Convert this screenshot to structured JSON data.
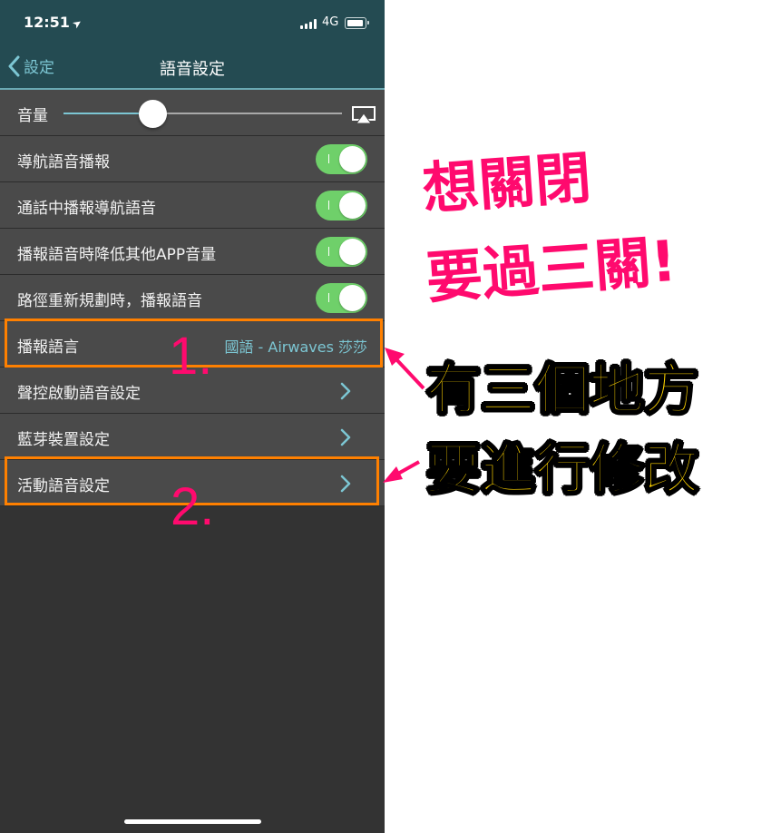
{
  "status_bar": {
    "time": "12:51",
    "location_icon": "location-arrow-icon",
    "network": "4G",
    "signal_icon": "signal-bars-icon",
    "battery_icon": "battery-icon"
  },
  "nav": {
    "back_label": "設定",
    "title": "語音設定"
  },
  "volume": {
    "label": "音量",
    "level_percent": 32,
    "airplay_icon": "airplay-icon"
  },
  "rows": [
    {
      "label": "導航語音播報",
      "type": "toggle",
      "on": true
    },
    {
      "label": "通話中播報導航語音",
      "type": "toggle",
      "on": true
    },
    {
      "label": "播報語音時降低其他APP音量",
      "type": "toggle",
      "on": true
    },
    {
      "label": "路徑重新規劃時，播報語音",
      "type": "toggle",
      "on": true
    },
    {
      "label": "播報語言",
      "type": "value",
      "value": "國語 - Airwaves 莎莎"
    },
    {
      "label": "聲控啟動語音設定",
      "type": "link"
    },
    {
      "label": "藍芽裝置設定",
      "type": "link"
    },
    {
      "label": "活動語音設定",
      "type": "link"
    }
  ],
  "annotations": {
    "number_1": "1.",
    "number_2": "2.",
    "headline_line1": "想關閉",
    "headline_line2": "要過三關!",
    "caption_line1": "有三個地方",
    "caption_line2": "要進行修改",
    "highlight_color": "#ff8000",
    "pink_color": "#ff0a6e",
    "yellow_color": "#ffd400"
  }
}
